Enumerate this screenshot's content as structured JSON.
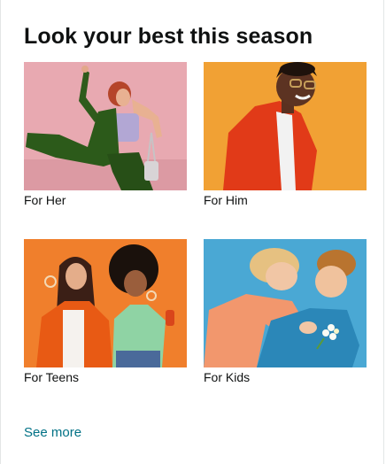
{
  "section": {
    "title": "Look your best this season"
  },
  "tiles": [
    {
      "label": "For Her",
      "image": "woman-dancing-green-suit",
      "bg_color": "#e8a9b1"
    },
    {
      "label": "For Him",
      "image": "man-red-jacket-sunglasses",
      "bg_color": "#f1a134"
    },
    {
      "label": "For Teens",
      "image": "two-teens-blowing-bubbles",
      "bg_color": "#f07f2c"
    },
    {
      "label": "For Kids",
      "image": "two-kids-hugging",
      "bg_color": "#4aa8d4"
    }
  ],
  "footer": {
    "see_more": "See more"
  },
  "colors": {
    "link": "#007185",
    "text": "#0f1111"
  }
}
